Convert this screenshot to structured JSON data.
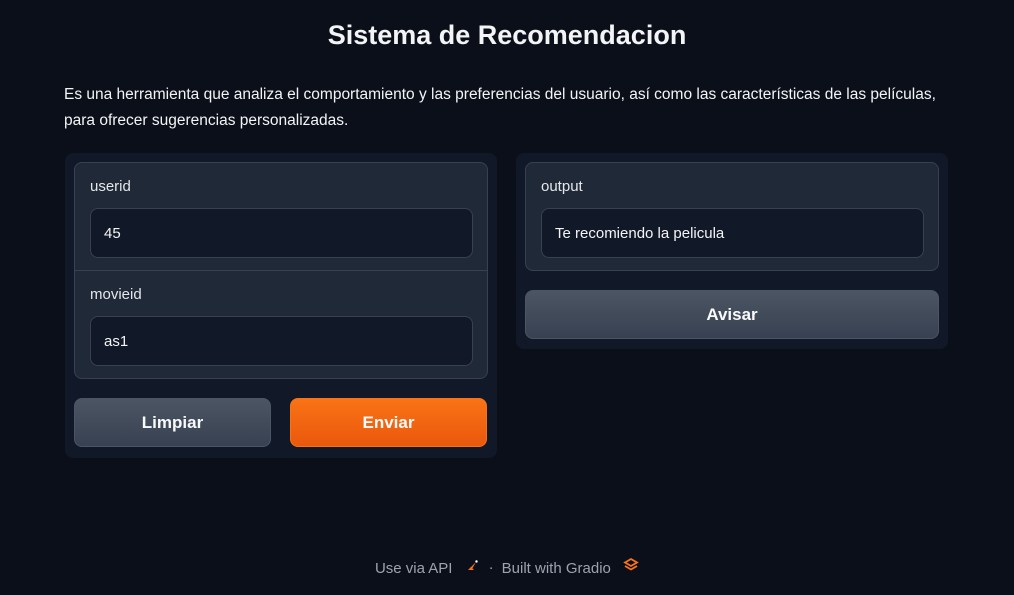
{
  "header": {
    "title": "Sistema de Recomendacion",
    "description": "Es una herramienta que analiza el comportamiento y las preferencias del usuario, así como las características de las películas, para ofrecer sugerencias personalizadas."
  },
  "inputs": {
    "userid": {
      "label": "userid",
      "value": "45"
    },
    "movieid": {
      "label": "movieid",
      "value": "as1"
    }
  },
  "outputs": {
    "output": {
      "label": "output",
      "value": "Te recomiendo la pelicula"
    }
  },
  "buttons": {
    "clear": "Limpiar",
    "submit": "Enviar",
    "flag": "Avisar"
  },
  "footer": {
    "api_link": "Use via API",
    "separator": "·",
    "built_with": "Built with Gradio"
  },
  "colors": {
    "background": "#0b0f19",
    "panel": "#111827",
    "block": "#1f2937",
    "accent": "#f97316"
  },
  "icons": {
    "api": "rocket-icon",
    "gradio": "gradio-logo-icon"
  }
}
